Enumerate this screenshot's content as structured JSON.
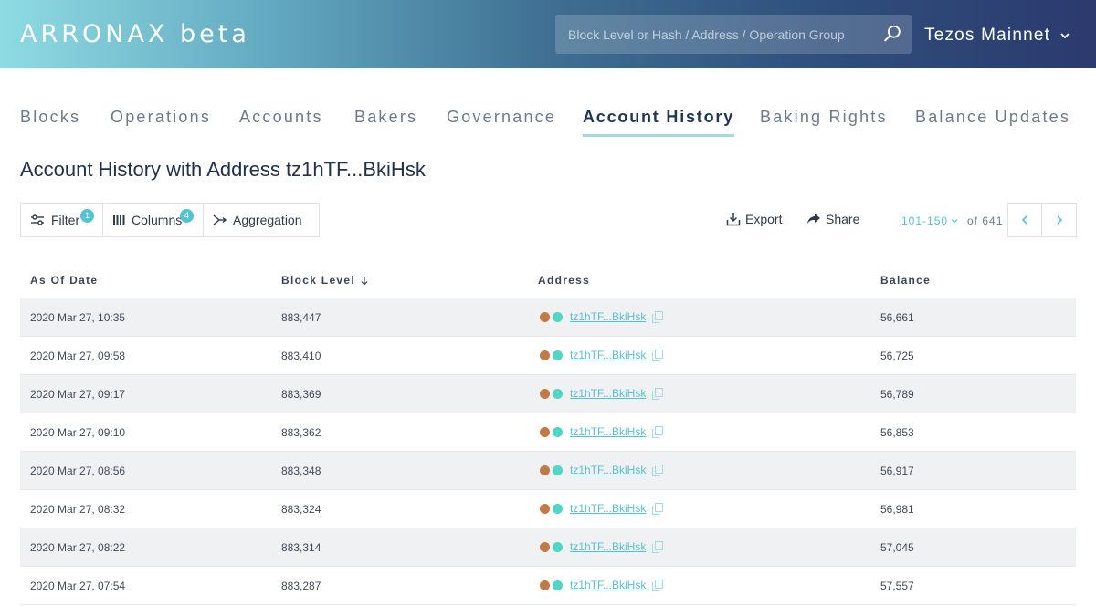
{
  "header": {
    "logo": "ARRONAX beta",
    "search_placeholder": "Block Level or Hash / Address / Operation Group",
    "network": "Tezos Mainnet"
  },
  "tabs": [
    {
      "label": "Blocks"
    },
    {
      "label": "Operations"
    },
    {
      "label": "Accounts"
    },
    {
      "label": "Bakers"
    },
    {
      "label": "Governance"
    },
    {
      "label": "Account History",
      "active": true
    },
    {
      "label": "Baking Rights"
    },
    {
      "label": "Balance Updates"
    }
  ],
  "page_title": "Account History with Address tz1hTF...BkiHsk",
  "toolbar": {
    "filter": {
      "label": "Filter",
      "badge": "1"
    },
    "columns": {
      "label": "Columns",
      "badge": "4"
    },
    "aggregation": {
      "label": "Aggregation"
    },
    "export": "Export",
    "share": "Share"
  },
  "pagination": {
    "range": "101-150",
    "of": "of 641"
  },
  "colors": {
    "accent": "#55c2d4",
    "dot_brown": "#c07a45",
    "dot_teal": "#4fd6c4"
  },
  "table": {
    "headers": {
      "date": "As Of Date",
      "block": "Block Level",
      "address": "Address",
      "balance": "Balance"
    },
    "rows": [
      {
        "date": "2020 Mar 27, 10:35",
        "block": "883,447",
        "address": "tz1hTF...BkiHsk",
        "balance": "56,661"
      },
      {
        "date": "2020 Mar 27, 09:58",
        "block": "883,410",
        "address": "tz1hTF...BkiHsk",
        "balance": "56,725"
      },
      {
        "date": "2020 Mar 27, 09:17",
        "block": "883,369",
        "address": "tz1hTF...BkiHsk",
        "balance": "56,789"
      },
      {
        "date": "2020 Mar 27, 09:10",
        "block": "883,362",
        "address": "tz1hTF...BkiHsk",
        "balance": "56,853"
      },
      {
        "date": "2020 Mar 27, 08:56",
        "block": "883,348",
        "address": "tz1hTF...BkiHsk",
        "balance": "56,917"
      },
      {
        "date": "2020 Mar 27, 08:32",
        "block": "883,324",
        "address": "tz1hTF...BkiHsk",
        "balance": "56,981"
      },
      {
        "date": "2020 Mar 27, 08:22",
        "block": "883,314",
        "address": "tz1hTF...BkiHsk",
        "balance": "57,045"
      },
      {
        "date": "2020 Mar 27, 07:54",
        "block": "883,287",
        "address": "tz1hTF...BkiHsk",
        "balance": "57,557"
      }
    ]
  }
}
